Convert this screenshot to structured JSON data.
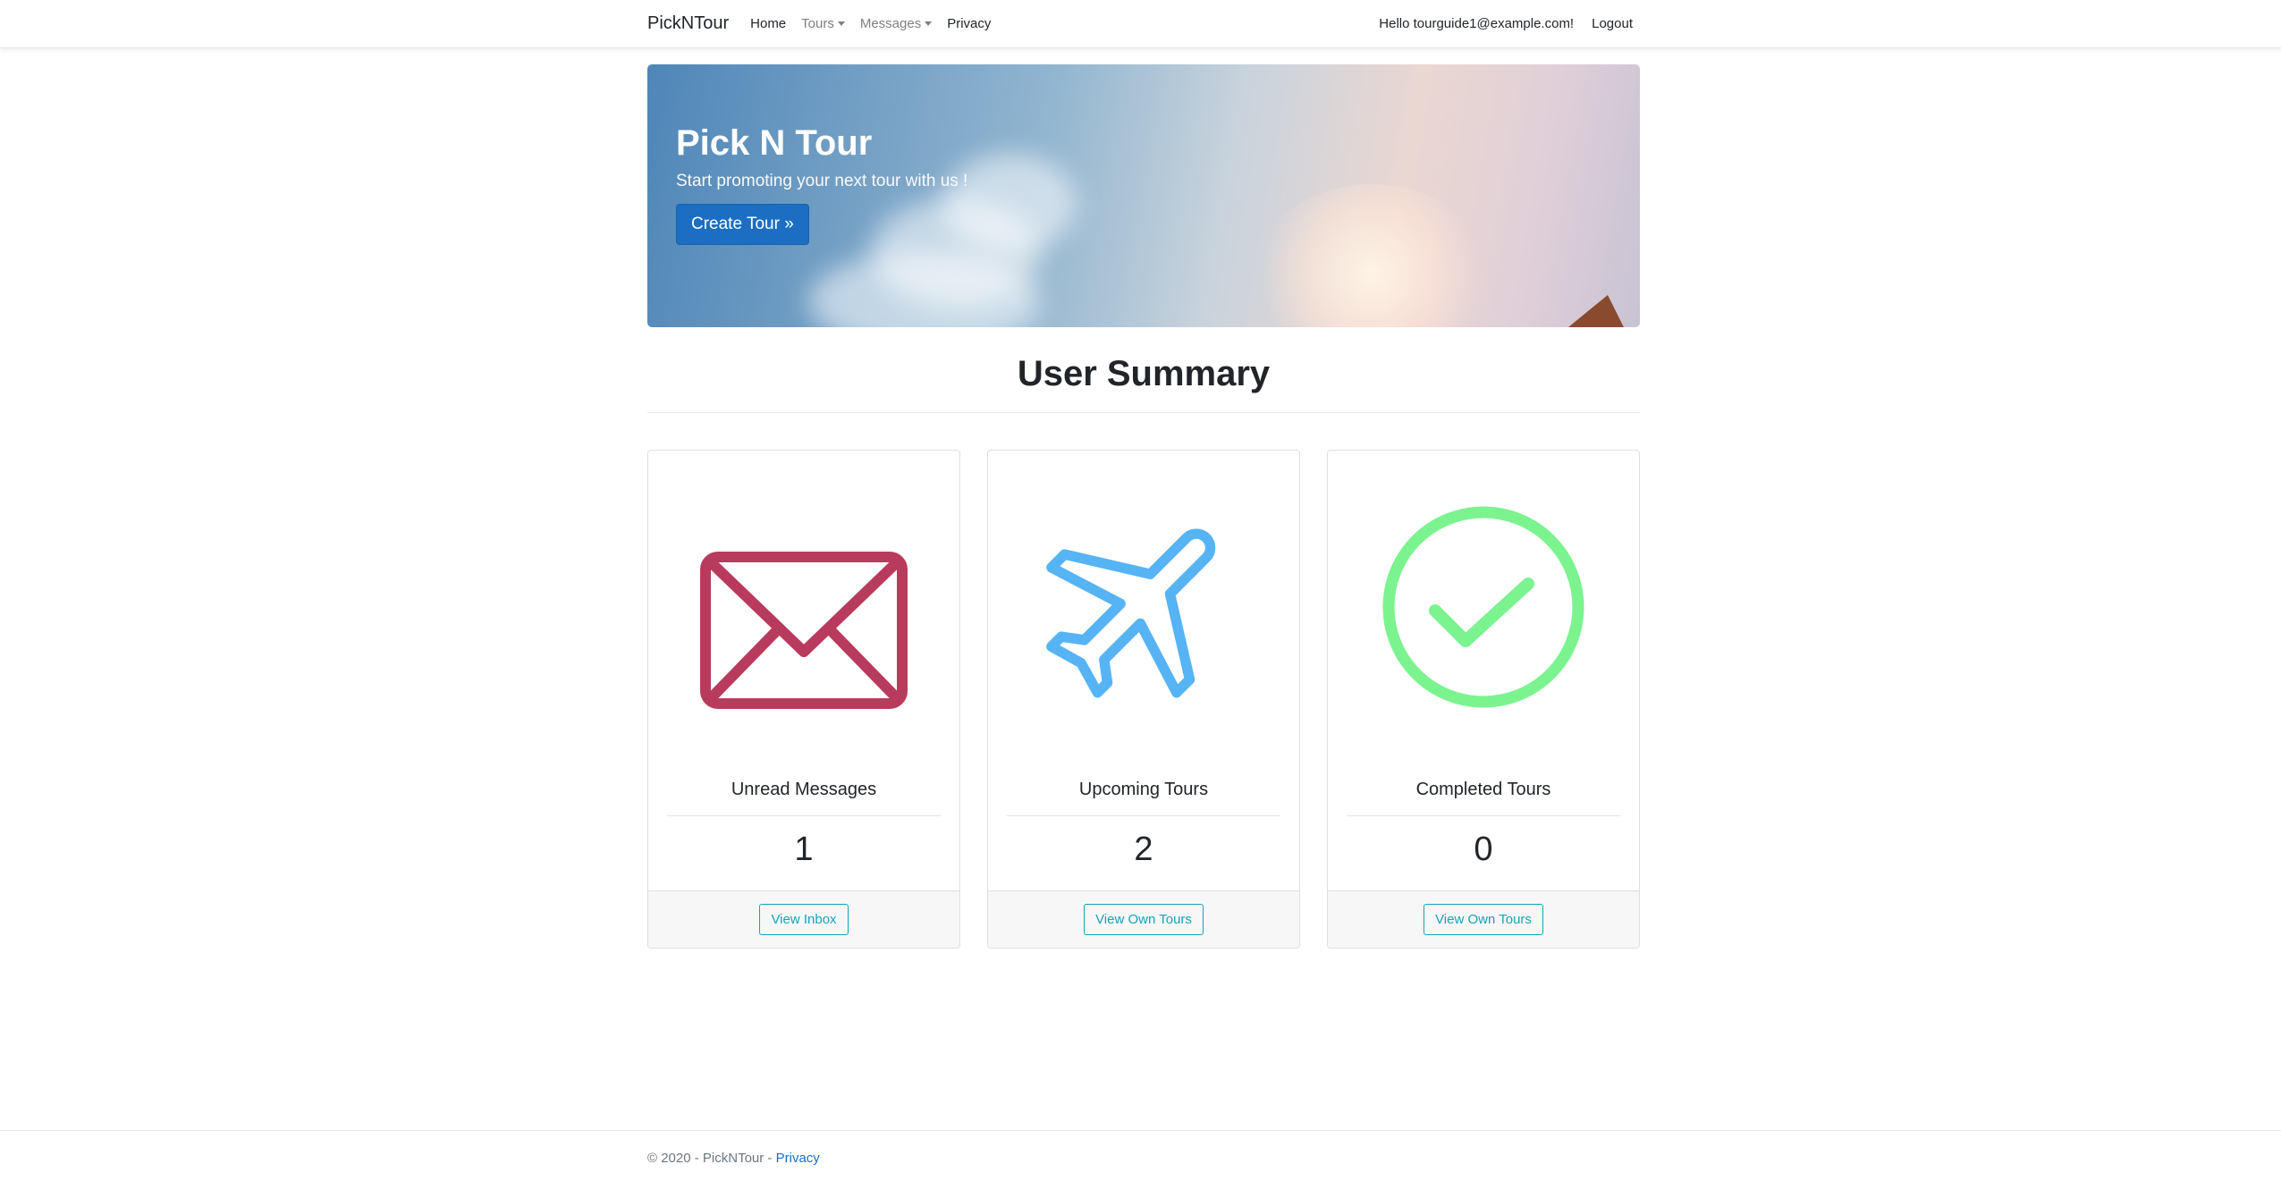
{
  "navbar": {
    "brand": "PickNTour",
    "links": [
      {
        "label": "Home"
      },
      {
        "label": "Tours"
      },
      {
        "label": "Messages"
      },
      {
        "label": "Privacy"
      }
    ],
    "greeting": "Hello tourguide1@example.com!",
    "logout": "Logout"
  },
  "hero": {
    "title": "Pick N Tour",
    "subtitle": "Start promoting your next tour with us !",
    "button": "Create Tour »"
  },
  "summary": {
    "title": "User Summary",
    "cards": [
      {
        "label": "Unread Messages",
        "value": "1",
        "button": "View Inbox",
        "icon": "envelope-icon",
        "color": "#b83b5e"
      },
      {
        "label": "Upcoming Tours",
        "value": "2",
        "button": "View Own Tours",
        "icon": "airplane-icon",
        "color": "#56b4f5"
      },
      {
        "label": "Completed Tours",
        "value": "0",
        "button": "View Own Tours",
        "icon": "check-circle-icon",
        "color": "#7bf38f"
      }
    ]
  },
  "footer": {
    "text": "© 2020 - PickNTour - ",
    "link": "Privacy"
  }
}
